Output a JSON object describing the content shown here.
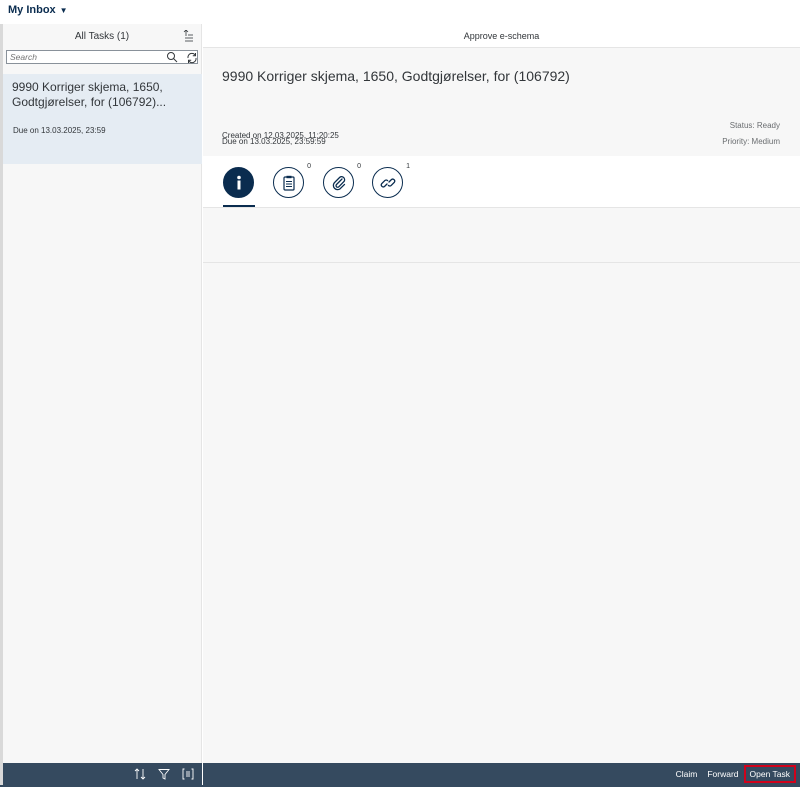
{
  "shell": {
    "app_title": "My Inbox"
  },
  "master": {
    "header_title": "All Tasks (1)",
    "search_placeholder": "Search",
    "tasks": [
      {
        "title": "9990 Korriger skjema, 1650, Godtgjørelser, for (106792)...",
        "due": "Due on 13.03.2025, 23:59"
      }
    ]
  },
  "detail": {
    "topbar_title": "Approve e-schema",
    "title": "9990 Korriger skjema, 1650, Godtgjørelser, for (106792)",
    "due": "Due on 13.03.2025, 23:59:59",
    "created": "Created on 12.03.2025, 11:20:25",
    "status": "Status: Ready",
    "priority": "Priority: Medium",
    "tabs": [
      {
        "icon": "info-icon",
        "count": ""
      },
      {
        "icon": "notes-icon",
        "count": "0"
      },
      {
        "icon": "attachment-icon",
        "count": "0"
      },
      {
        "icon": "link-icon",
        "count": "1"
      }
    ]
  },
  "footer": {
    "claim": "Claim",
    "forward": "Forward",
    "open_task": "Open Task"
  },
  "colors": {
    "shell_dark": "#354a5f",
    "brand_dark": "#0a2c4f",
    "selected_item": "#e5ecf3",
    "highlight_border": "#d0021b"
  }
}
